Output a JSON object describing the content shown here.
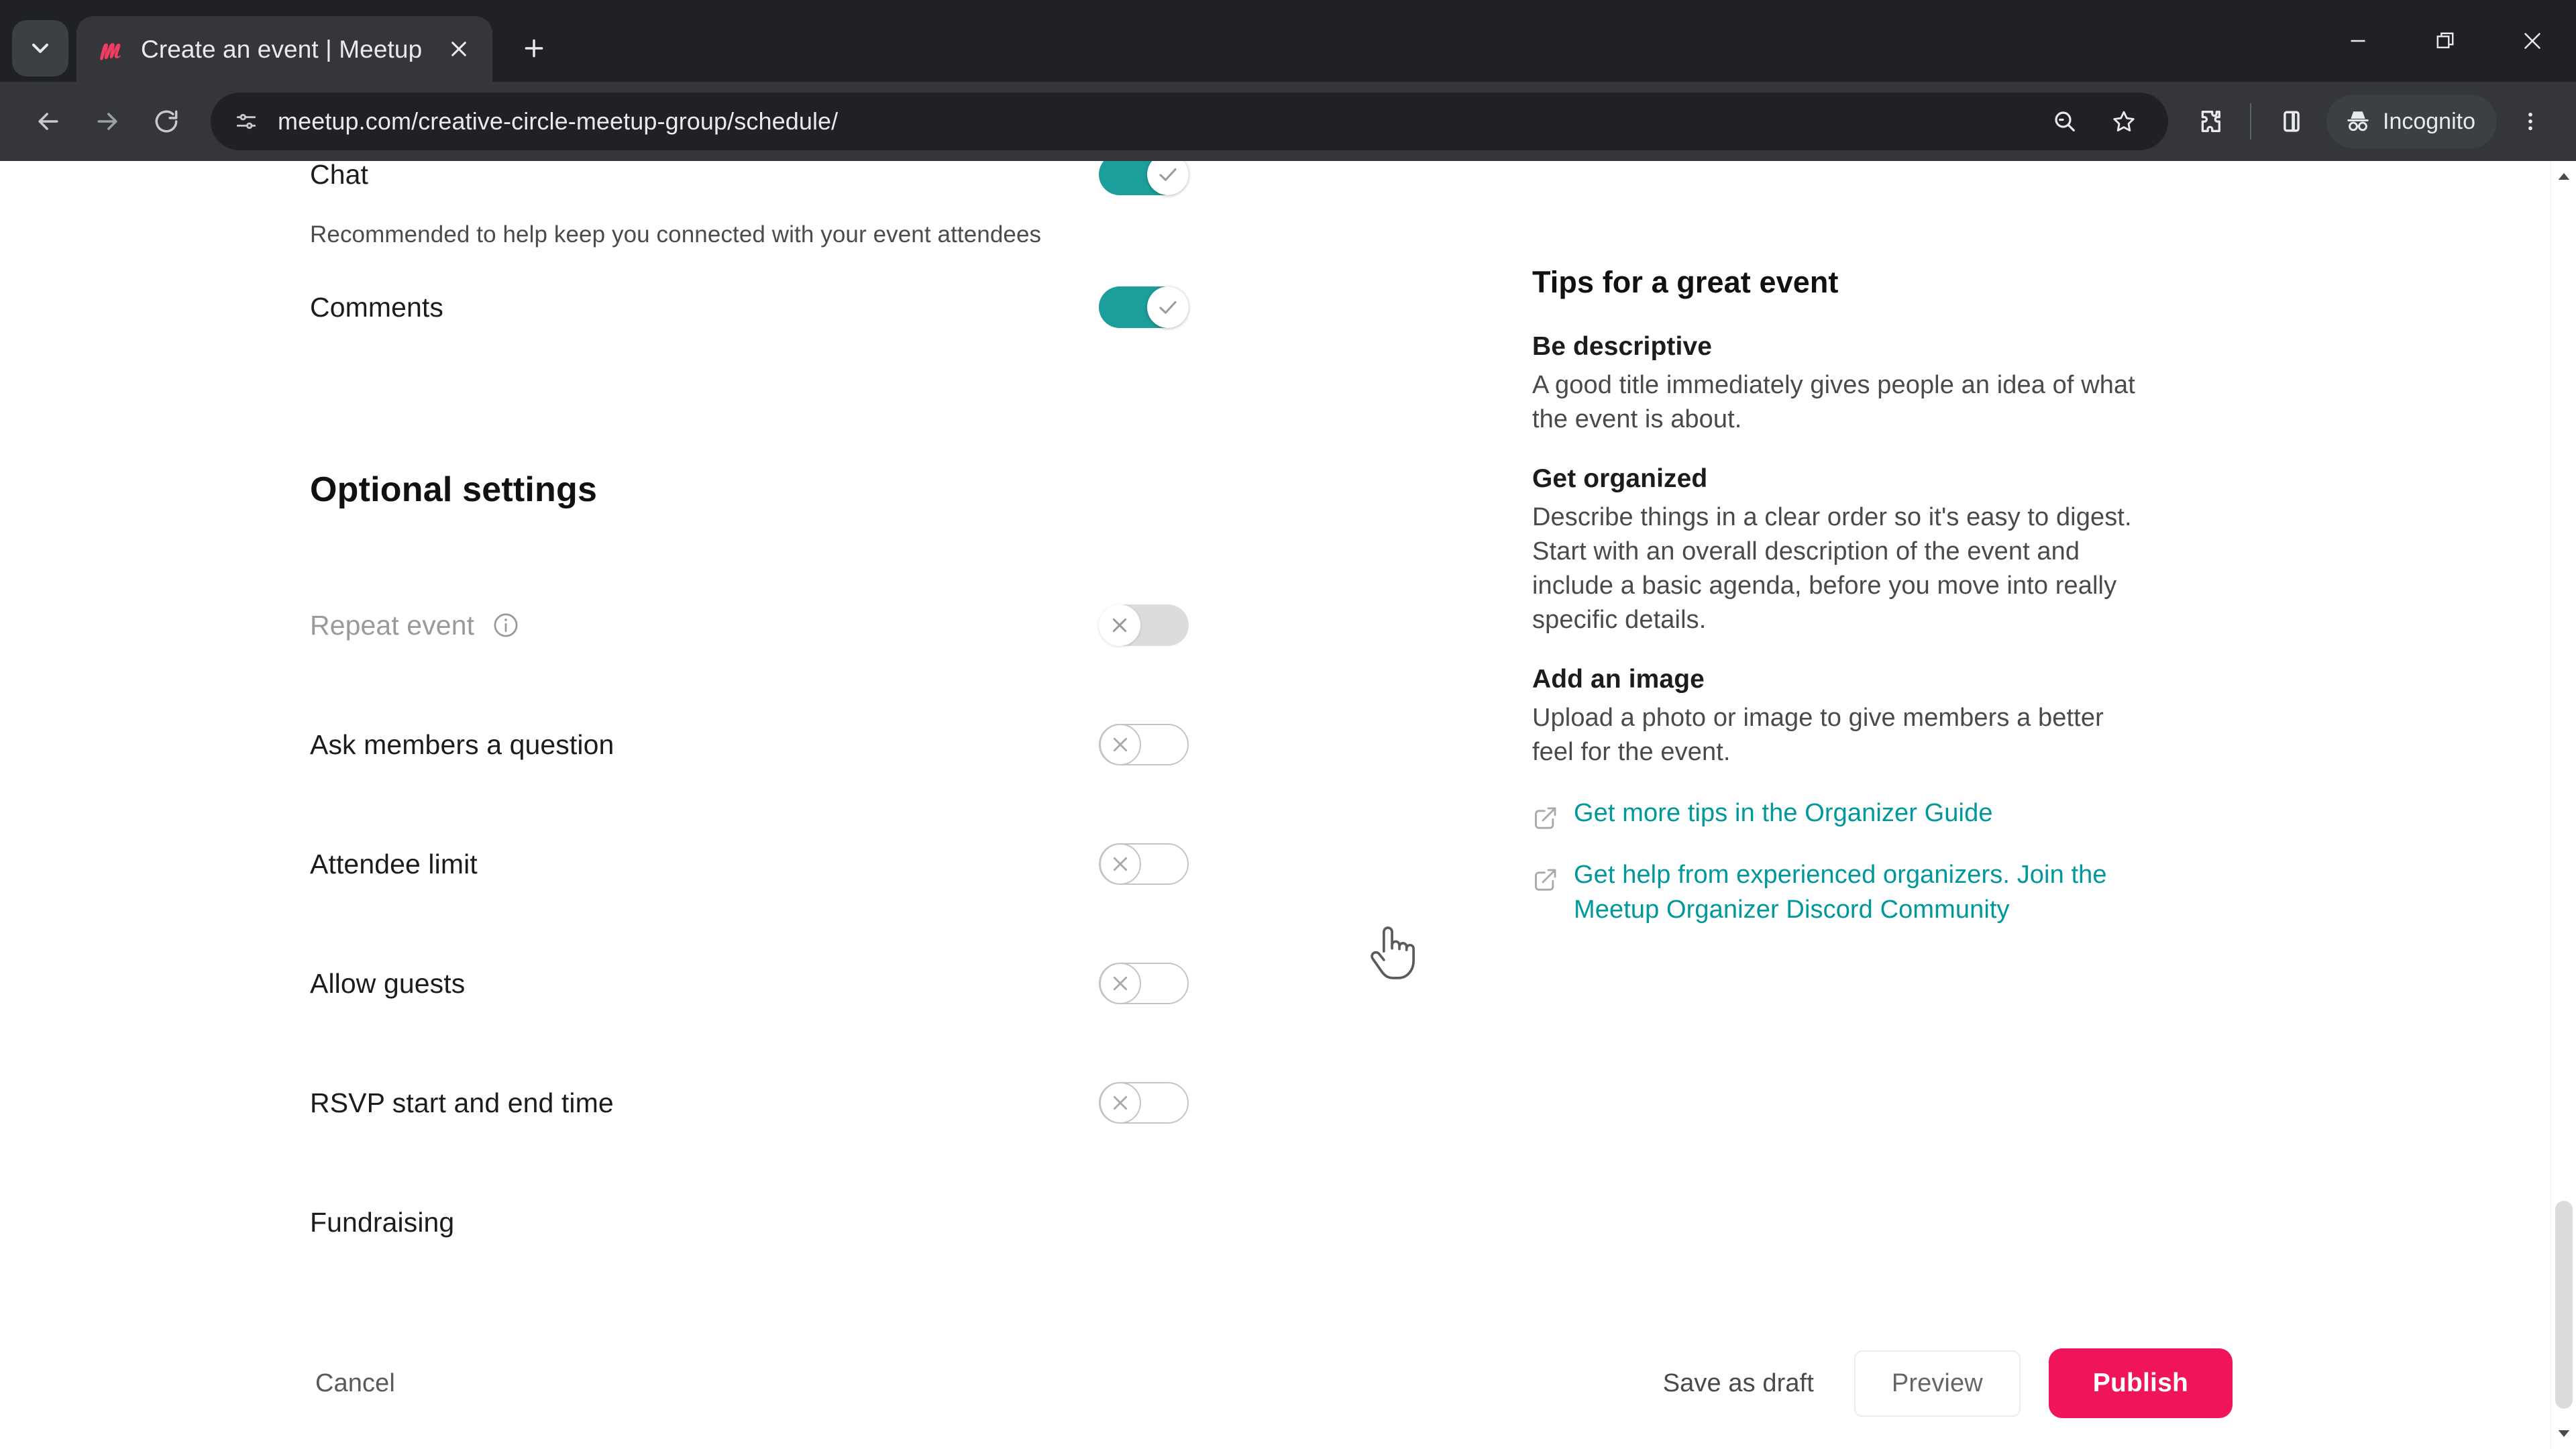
{
  "browser": {
    "tab": {
      "title": "Create an event | Meetup",
      "favicon": "meetup-logo-icon"
    },
    "new_tab_label": "+",
    "url": "meetup.com/creative-circle-meetup-group/schedule/",
    "profile_label": "Incognito",
    "icons": {
      "tab_search": "chevron-down-icon",
      "back": "back-arrow-icon",
      "forward": "forward-arrow-icon",
      "reload": "reload-icon",
      "site_info": "page-settings-icon",
      "zoom_search": "search-minus-icon",
      "bookmark": "star-icon",
      "extensions": "puzzle-piece-icon",
      "side_panel": "side-panel-icon",
      "incognito": "incognito-hat-icon",
      "menu": "three-dot-menu-icon",
      "minimize": "minimize-icon",
      "maximize": "maximize-icon",
      "close": "close-icon"
    }
  },
  "page": {
    "top_settings": [
      {
        "label": "Chat",
        "sub": "Recommended to help keep you connected with your event attendees",
        "state": "on",
        "clipped": true
      },
      {
        "label": "Comments",
        "sub": "",
        "state": "on",
        "clipped": false
      }
    ],
    "optional_heading": "Optional settings",
    "optional_settings": [
      {
        "label": "Repeat event",
        "state": "disabled",
        "has_info_icon": true
      },
      {
        "label": "Ask members a question",
        "state": "off",
        "has_info_icon": false
      },
      {
        "label": "Attendee limit",
        "state": "off",
        "has_info_icon": false
      },
      {
        "label": "Allow guests",
        "state": "off",
        "has_info_icon": false
      },
      {
        "label": "RSVP start and end time",
        "state": "off",
        "has_info_icon": false
      },
      {
        "label": "Fundraising",
        "state": "none",
        "has_info_icon": false
      }
    ],
    "tips": {
      "title": "Tips for a great event",
      "blocks": [
        {
          "head": "Be descriptive",
          "body": "A good title immediately gives people an idea of what the event is about."
        },
        {
          "head": "Get organized",
          "body": "Describe things in a clear order so it's easy to digest. Start with an overall description of the event and include a basic agenda, before you move into really specific details."
        },
        {
          "head": "Add an image",
          "body": "Upload a photo or image to give members a better feel for the event."
        }
      ],
      "links": [
        {
          "text": "Get more tips in the Organizer Guide",
          "icon": "external-link-icon"
        },
        {
          "text": "Get help from experienced organizers. Join the Meetup Organizer Discord Community",
          "icon": "external-link-icon"
        }
      ]
    },
    "footer": {
      "cancel_label": "Cancel",
      "save_draft_label": "Save as draft",
      "preview_label": "Preview",
      "publish_label": "Publish"
    }
  },
  "colors": {
    "toggle_on": "#1b9e9c",
    "publish_button": "#f0145a",
    "link_teal": "#00989a",
    "chrome_dark": "#202124",
    "chrome_toolbar": "#35363a",
    "meetup_red": "#f13c63"
  }
}
